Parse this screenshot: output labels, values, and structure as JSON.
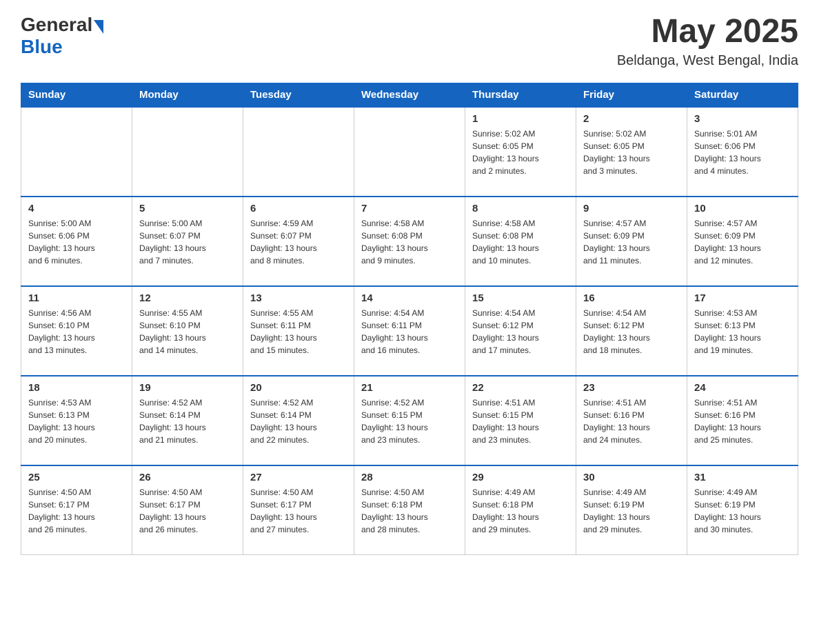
{
  "header": {
    "logo_general": "General",
    "logo_blue": "Blue",
    "month_year": "May 2025",
    "location": "Beldanga, West Bengal, India"
  },
  "days_of_week": [
    "Sunday",
    "Monday",
    "Tuesday",
    "Wednesday",
    "Thursday",
    "Friday",
    "Saturday"
  ],
  "weeks": [
    [
      {
        "day": "",
        "info": ""
      },
      {
        "day": "",
        "info": ""
      },
      {
        "day": "",
        "info": ""
      },
      {
        "day": "",
        "info": ""
      },
      {
        "day": "1",
        "info": "Sunrise: 5:02 AM\nSunset: 6:05 PM\nDaylight: 13 hours\nand 2 minutes."
      },
      {
        "day": "2",
        "info": "Sunrise: 5:02 AM\nSunset: 6:05 PM\nDaylight: 13 hours\nand 3 minutes."
      },
      {
        "day": "3",
        "info": "Sunrise: 5:01 AM\nSunset: 6:06 PM\nDaylight: 13 hours\nand 4 minutes."
      }
    ],
    [
      {
        "day": "4",
        "info": "Sunrise: 5:00 AM\nSunset: 6:06 PM\nDaylight: 13 hours\nand 6 minutes."
      },
      {
        "day": "5",
        "info": "Sunrise: 5:00 AM\nSunset: 6:07 PM\nDaylight: 13 hours\nand 7 minutes."
      },
      {
        "day": "6",
        "info": "Sunrise: 4:59 AM\nSunset: 6:07 PM\nDaylight: 13 hours\nand 8 minutes."
      },
      {
        "day": "7",
        "info": "Sunrise: 4:58 AM\nSunset: 6:08 PM\nDaylight: 13 hours\nand 9 minutes."
      },
      {
        "day": "8",
        "info": "Sunrise: 4:58 AM\nSunset: 6:08 PM\nDaylight: 13 hours\nand 10 minutes."
      },
      {
        "day": "9",
        "info": "Sunrise: 4:57 AM\nSunset: 6:09 PM\nDaylight: 13 hours\nand 11 minutes."
      },
      {
        "day": "10",
        "info": "Sunrise: 4:57 AM\nSunset: 6:09 PM\nDaylight: 13 hours\nand 12 minutes."
      }
    ],
    [
      {
        "day": "11",
        "info": "Sunrise: 4:56 AM\nSunset: 6:10 PM\nDaylight: 13 hours\nand 13 minutes."
      },
      {
        "day": "12",
        "info": "Sunrise: 4:55 AM\nSunset: 6:10 PM\nDaylight: 13 hours\nand 14 minutes."
      },
      {
        "day": "13",
        "info": "Sunrise: 4:55 AM\nSunset: 6:11 PM\nDaylight: 13 hours\nand 15 minutes."
      },
      {
        "day": "14",
        "info": "Sunrise: 4:54 AM\nSunset: 6:11 PM\nDaylight: 13 hours\nand 16 minutes."
      },
      {
        "day": "15",
        "info": "Sunrise: 4:54 AM\nSunset: 6:12 PM\nDaylight: 13 hours\nand 17 minutes."
      },
      {
        "day": "16",
        "info": "Sunrise: 4:54 AM\nSunset: 6:12 PM\nDaylight: 13 hours\nand 18 minutes."
      },
      {
        "day": "17",
        "info": "Sunrise: 4:53 AM\nSunset: 6:13 PM\nDaylight: 13 hours\nand 19 minutes."
      }
    ],
    [
      {
        "day": "18",
        "info": "Sunrise: 4:53 AM\nSunset: 6:13 PM\nDaylight: 13 hours\nand 20 minutes."
      },
      {
        "day": "19",
        "info": "Sunrise: 4:52 AM\nSunset: 6:14 PM\nDaylight: 13 hours\nand 21 minutes."
      },
      {
        "day": "20",
        "info": "Sunrise: 4:52 AM\nSunset: 6:14 PM\nDaylight: 13 hours\nand 22 minutes."
      },
      {
        "day": "21",
        "info": "Sunrise: 4:52 AM\nSunset: 6:15 PM\nDaylight: 13 hours\nand 23 minutes."
      },
      {
        "day": "22",
        "info": "Sunrise: 4:51 AM\nSunset: 6:15 PM\nDaylight: 13 hours\nand 23 minutes."
      },
      {
        "day": "23",
        "info": "Sunrise: 4:51 AM\nSunset: 6:16 PM\nDaylight: 13 hours\nand 24 minutes."
      },
      {
        "day": "24",
        "info": "Sunrise: 4:51 AM\nSunset: 6:16 PM\nDaylight: 13 hours\nand 25 minutes."
      }
    ],
    [
      {
        "day": "25",
        "info": "Sunrise: 4:50 AM\nSunset: 6:17 PM\nDaylight: 13 hours\nand 26 minutes."
      },
      {
        "day": "26",
        "info": "Sunrise: 4:50 AM\nSunset: 6:17 PM\nDaylight: 13 hours\nand 26 minutes."
      },
      {
        "day": "27",
        "info": "Sunrise: 4:50 AM\nSunset: 6:17 PM\nDaylight: 13 hours\nand 27 minutes."
      },
      {
        "day": "28",
        "info": "Sunrise: 4:50 AM\nSunset: 6:18 PM\nDaylight: 13 hours\nand 28 minutes."
      },
      {
        "day": "29",
        "info": "Sunrise: 4:49 AM\nSunset: 6:18 PM\nDaylight: 13 hours\nand 29 minutes."
      },
      {
        "day": "30",
        "info": "Sunrise: 4:49 AM\nSunset: 6:19 PM\nDaylight: 13 hours\nand 29 minutes."
      },
      {
        "day": "31",
        "info": "Sunrise: 4:49 AM\nSunset: 6:19 PM\nDaylight: 13 hours\nand 30 minutes."
      }
    ]
  ]
}
